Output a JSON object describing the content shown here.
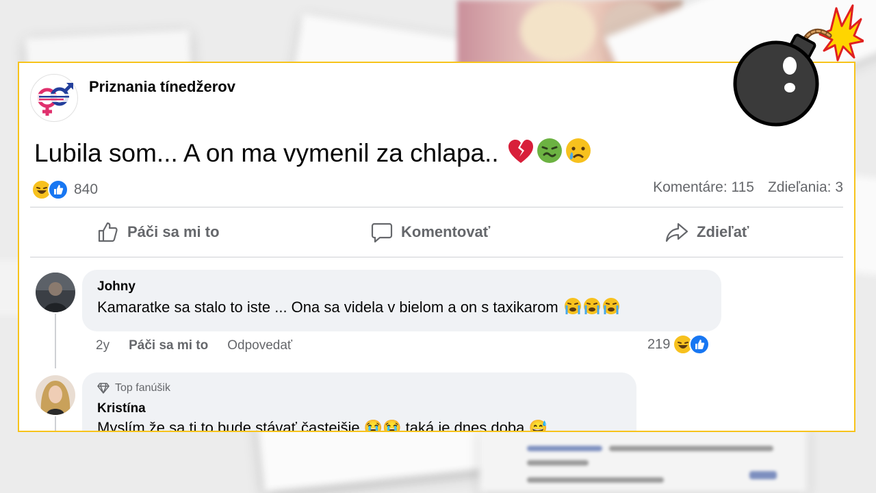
{
  "post": {
    "page_name": "Priznania tínedžerov",
    "text": "Lubila som... A on ma vymenil za chlapa..",
    "text_emojis": [
      "broken-heart-emoji",
      "nauseated-face-emoji",
      "crying-face-emoji"
    ],
    "reaction_count": "840",
    "comments_stat": "Komentáre: 115",
    "shares_stat": "Zdieľania: 3"
  },
  "actions": {
    "like": "Páči sa mi to",
    "comment": "Komentovať",
    "share": "Zdieľať"
  },
  "comments": [
    {
      "name": "Johny",
      "text": "Kamaratke sa stalo to iste ... Ona sa videla v bielom a on s taxikarom",
      "age": "2y",
      "like_label": "Páči sa mi to",
      "reply_label": "Odpovedať",
      "reaction_count": "219"
    },
    {
      "badge": "Top fanúšik",
      "name": "Kristína",
      "text": "Myslím že sa ti to bude stávať častejšie 😭😭 taká je dnes doba 😅"
    }
  ],
  "colors": {
    "frame_border": "#f7c31a",
    "like_blue": "#1877f2",
    "haha_yellow": "#f7c11e",
    "meta_gray": "#65676b",
    "bubble_bg": "#f0f2f5"
  },
  "icons": {
    "like": "thumbs-up-icon",
    "comment": "speech-bubble-icon",
    "share": "share-arrow-icon",
    "badge": "diamond-icon",
    "decoration": "bomb-icon"
  }
}
